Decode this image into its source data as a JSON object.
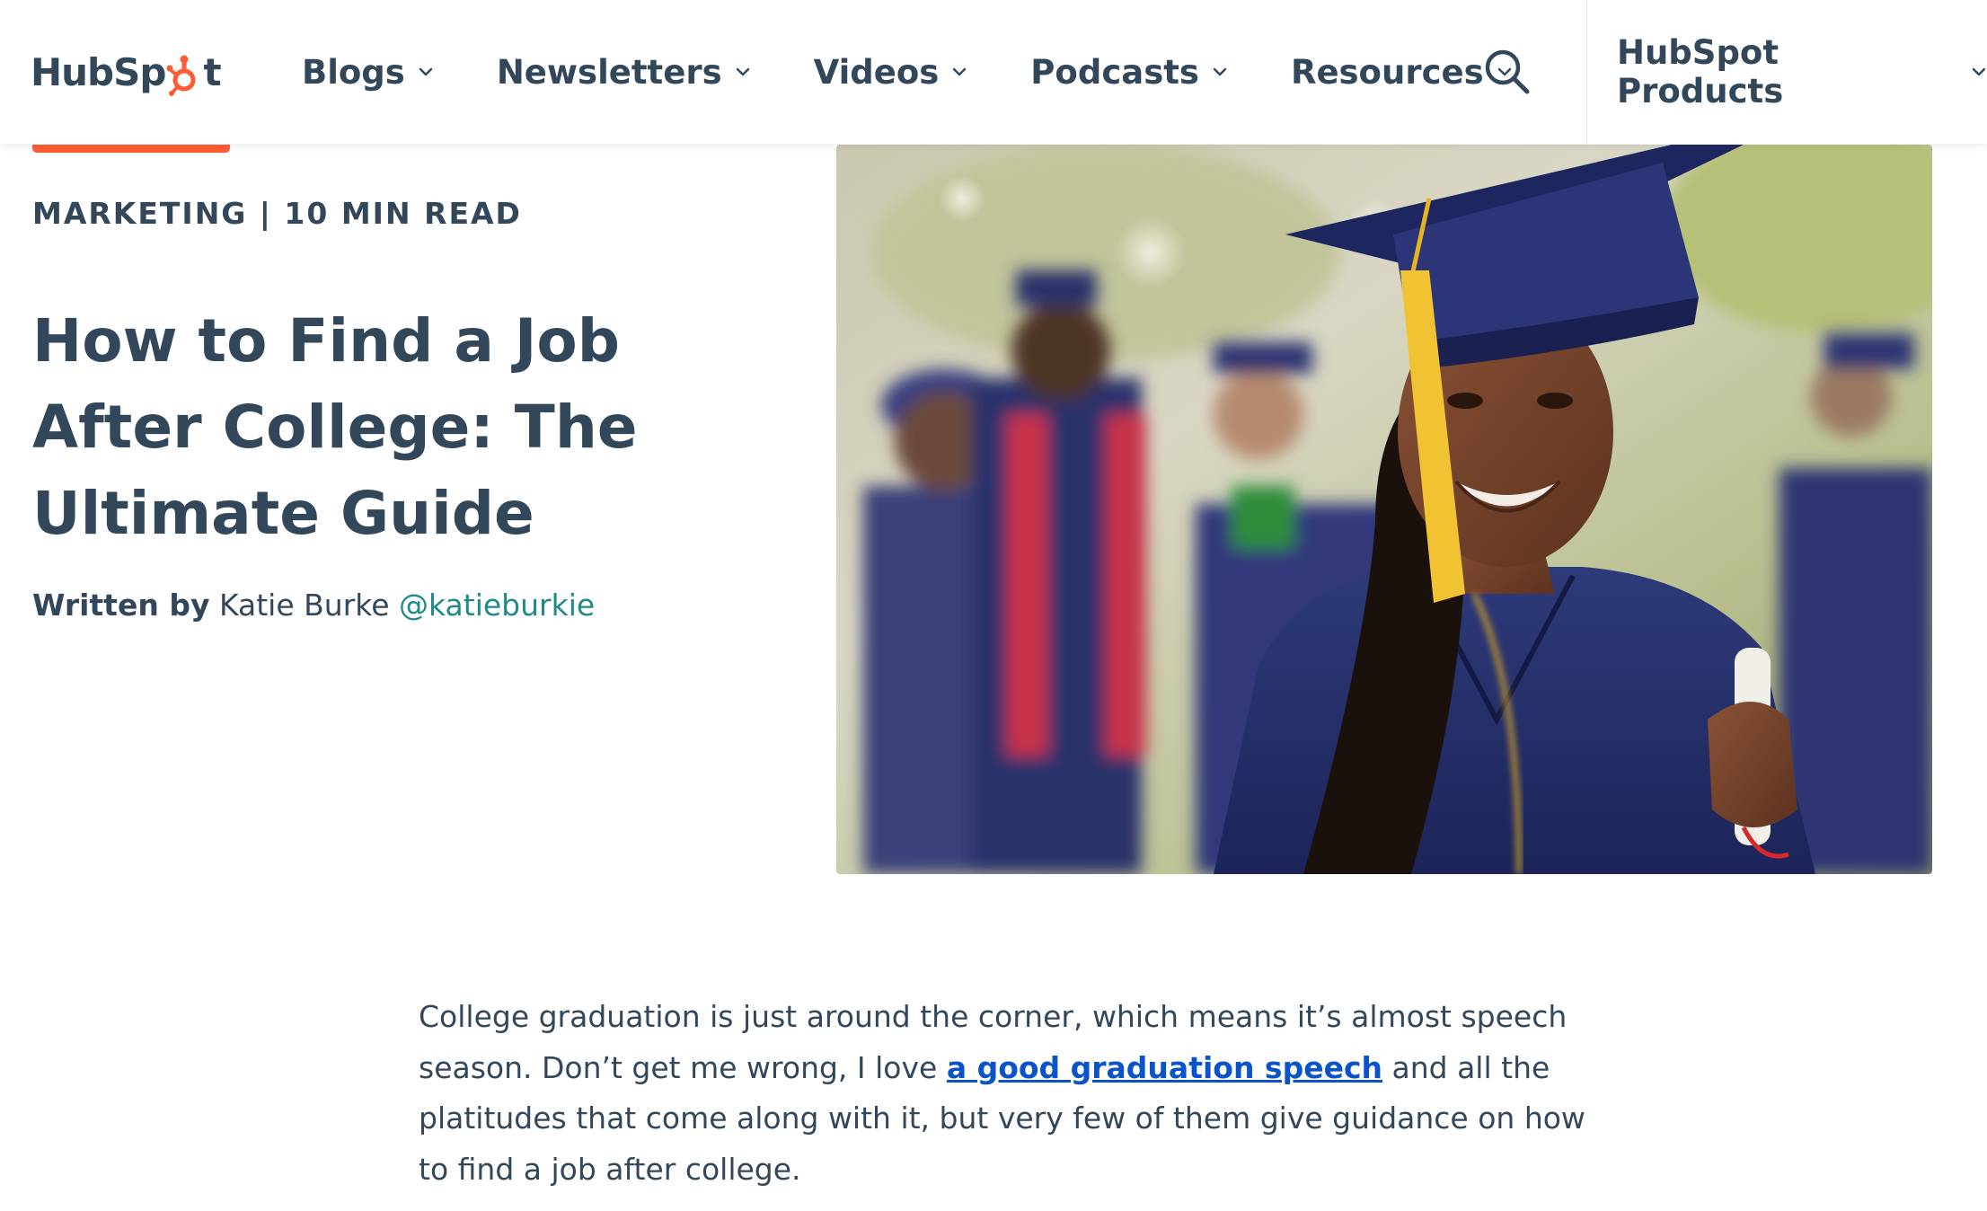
{
  "header": {
    "logo": {
      "text_left": "HubSp",
      "text_right": "t",
      "icon": "sprocket-icon",
      "brand_color": "#ff5c35"
    },
    "nav": [
      {
        "label": "Blogs",
        "icon": "chevron-down-icon"
      },
      {
        "label": "Newsletters",
        "icon": "chevron-down-icon"
      },
      {
        "label": "Videos",
        "icon": "chevron-down-icon"
      },
      {
        "label": "Podcasts",
        "icon": "chevron-down-icon"
      },
      {
        "label": "Resources",
        "icon": "chevron-down-icon"
      }
    ],
    "search_icon": "search-icon",
    "products_label": "HubSpot Products"
  },
  "article": {
    "eyebrow": "MARKETING | 10 MIN READ",
    "title": "How to Find a Job After College: The Ultimate Guide",
    "byline": {
      "written_by": "Written by",
      "author": "Katie Burke",
      "handle": "@katieburkie"
    },
    "hero_image": "graduate-photo",
    "intro": {
      "before_link": "College graduation is just around the corner, which means it’s almost speech season. Don’t get me wrong, I love ",
      "link_text": "a good graduation speech",
      "after_link": " and all the platitudes that come along with it, but very few of them give guidance on how to find a job after college."
    }
  },
  "colors": {
    "text": "#33475b",
    "accent": "#ff5c35",
    "teal_link": "#1f8a8a",
    "body_link": "#0b53c8"
  }
}
